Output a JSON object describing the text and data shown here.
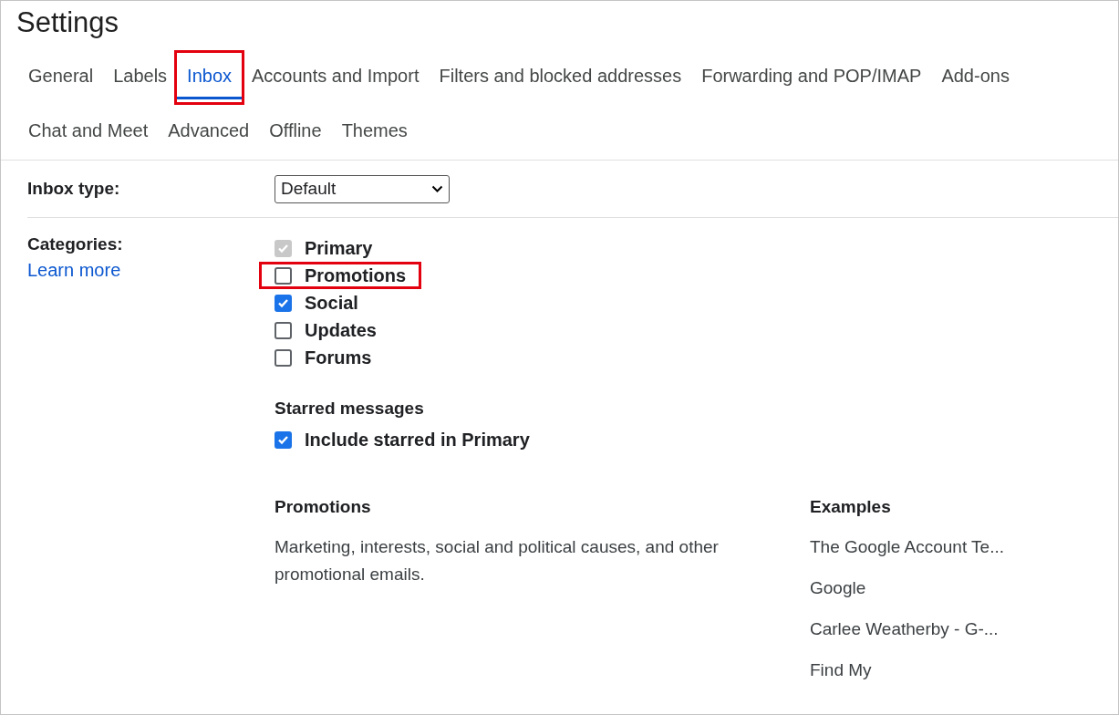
{
  "window": {
    "title": "Settings"
  },
  "tabs": [
    {
      "label": "General",
      "selected": false,
      "highlighted": false
    },
    {
      "label": "Labels",
      "selected": false,
      "highlighted": false
    },
    {
      "label": "Inbox",
      "selected": true,
      "highlighted": true
    },
    {
      "label": "Accounts and Import",
      "selected": false,
      "highlighted": false
    },
    {
      "label": "Filters and blocked addresses",
      "selected": false,
      "highlighted": false
    },
    {
      "label": "Forwarding and POP/IMAP",
      "selected": false,
      "highlighted": false
    },
    {
      "label": "Add-ons",
      "selected": false,
      "highlighted": false
    },
    {
      "label": "Chat and Meet",
      "selected": false,
      "highlighted": false
    },
    {
      "label": "Advanced",
      "selected": false,
      "highlighted": false
    },
    {
      "label": "Offline",
      "selected": false,
      "highlighted": false
    },
    {
      "label": "Themes",
      "selected": false,
      "highlighted": false
    }
  ],
  "inbox_type": {
    "label": "Inbox type:",
    "value": "Default"
  },
  "categories": {
    "label": "Categories:",
    "link": "Learn more",
    "options": [
      {
        "label": "Primary",
        "checked": true,
        "disabled": true,
        "highlighted": false
      },
      {
        "label": "Promotions",
        "checked": false,
        "disabled": false,
        "highlighted": true
      },
      {
        "label": "Social",
        "checked": true,
        "disabled": false,
        "highlighted": false
      },
      {
        "label": "Updates",
        "checked": false,
        "disabled": false,
        "highlighted": false
      },
      {
        "label": "Forums",
        "checked": false,
        "disabled": false,
        "highlighted": false
      }
    ]
  },
  "starred": {
    "heading": "Starred messages",
    "option": {
      "label": "Include starred in Primary",
      "checked": true,
      "disabled": false
    }
  },
  "description": {
    "heading": "Promotions",
    "text": "Marketing, interests, social and political causes, and other promotional emails."
  },
  "examples": {
    "heading": "Examples",
    "items": [
      "The Google Account Te...",
      "Google",
      "Carlee Weatherby - G-...",
      "Find My"
    ]
  }
}
